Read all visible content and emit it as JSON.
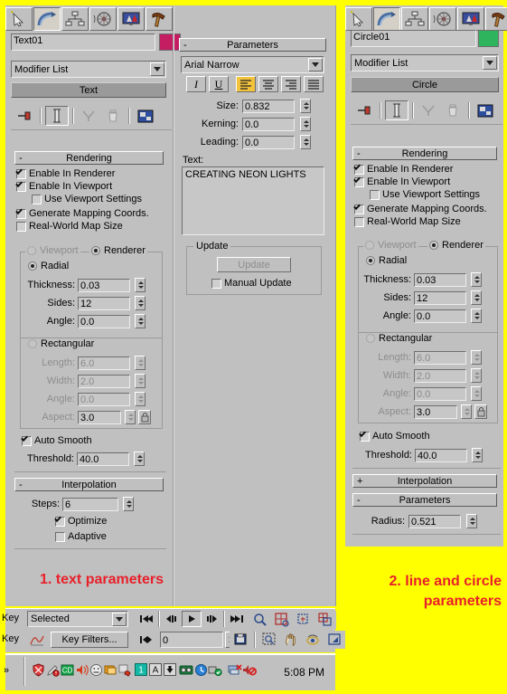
{
  "colors": {
    "border_yellow": "#ffff00",
    "panel_gray": "#c0c0c0",
    "caption_red": "#e8202a",
    "text01_swatch": "#c41d62",
    "circle01_swatch": "#2fb45e",
    "align_highlight": "#f3c33c"
  },
  "left_panel": {
    "tabs": [
      {
        "name": "create-tab",
        "icon": "arrow-star-icon",
        "selected": false
      },
      {
        "name": "modify-tab",
        "icon": "rainbow-arc-icon",
        "selected": true
      },
      {
        "name": "hierarchy-tab",
        "icon": "hierarchy-tree-icon",
        "selected": false
      },
      {
        "name": "motion-tab",
        "icon": "wheel-icon",
        "selected": false
      },
      {
        "name": "display-tab",
        "icon": "monitor-icon",
        "selected": false
      },
      {
        "name": "utilities-tab",
        "icon": "hammer-icon",
        "selected": false
      }
    ],
    "object_name": "Text01",
    "modifier_list_label": "Modifier List",
    "stack_item": "Text",
    "stack_tools": [
      {
        "name": "pin-stack-button",
        "icon": "pin-icon"
      },
      {
        "name": "show-end-result-button",
        "icon": "show-end-result-icon"
      },
      {
        "name": "make-unique-button",
        "icon": "make-unique-icon"
      },
      {
        "name": "remove-modifier-button",
        "icon": "trash-icon"
      },
      {
        "name": "configure-modifier-sets-button",
        "icon": "configure-sets-icon"
      }
    ],
    "rendering": {
      "title": "Rendering",
      "expanded": true,
      "enable_in_renderer": {
        "label": "Enable In Renderer",
        "checked": true
      },
      "enable_in_viewport": {
        "label": "Enable In Viewport",
        "checked": true
      },
      "use_viewport_settings": {
        "label": "Use Viewport Settings",
        "checked": false
      },
      "generate_mapping_coords": {
        "label": "Generate Mapping Coords.",
        "checked": true
      },
      "real_world_map_size": {
        "label": "Real-World Map Size",
        "checked": false
      },
      "viewport_radio": {
        "label": "Viewport",
        "selected": false,
        "disabled": true
      },
      "renderer_radio": {
        "label": "Renderer",
        "selected": true
      },
      "radial": {
        "label": "Radial",
        "selected": true
      },
      "thickness": {
        "label": "Thickness:",
        "value": "0.03"
      },
      "sides": {
        "label": "Sides:",
        "value": "12"
      },
      "angle": {
        "label": "Angle:",
        "value": "0.0"
      },
      "rectangular": {
        "label": "Rectangular",
        "selected": false
      },
      "length": {
        "label": "Length:",
        "value": "6.0"
      },
      "width": {
        "label": "Width:",
        "value": "2.0"
      },
      "rect_angle": {
        "label": "Angle:",
        "value": "0.0"
      },
      "aspect": {
        "label": "Aspect:",
        "value": "3.0"
      },
      "auto_smooth": {
        "label": "Auto Smooth",
        "checked": true
      },
      "threshold": {
        "label": "Threshold:",
        "value": "40.0"
      }
    },
    "interpolation": {
      "title": "Interpolation",
      "expanded": true,
      "steps": {
        "label": "Steps:",
        "value": "6"
      },
      "optimize": {
        "label": "Optimize",
        "checked": true
      },
      "adaptive": {
        "label": "Adaptive",
        "checked": false
      }
    }
  },
  "middle_panel": {
    "title": "Parameters",
    "font": "Arial Narrow",
    "style_buttons": [
      {
        "name": "italic-button",
        "label": "I",
        "active": false
      },
      {
        "name": "underline-button",
        "label": "U",
        "active": false
      }
    ],
    "align_buttons": [
      {
        "name": "align-left-button",
        "icon": "align-left-icon",
        "active": true
      },
      {
        "name": "align-center-button",
        "icon": "align-center-icon",
        "active": false
      },
      {
        "name": "align-right-button",
        "icon": "align-right-icon",
        "active": false
      },
      {
        "name": "align-justify-button",
        "icon": "align-justify-icon",
        "active": false
      }
    ],
    "size": {
      "label": "Size:",
      "value": "0.832"
    },
    "kerning": {
      "label": "Kerning:",
      "value": "0.0"
    },
    "leading": {
      "label": "Leading:",
      "value": "0.0"
    },
    "text_label": "Text:",
    "text_value": "CREATING NEON LIGHTS",
    "update": {
      "group_label": "Update",
      "button_label": "Update",
      "manual_update": {
        "label": "Manual Update",
        "checked": false
      }
    }
  },
  "right_panel": {
    "tabs": [
      {
        "name": "create-tab",
        "icon": "arrow-star-icon",
        "selected": false
      },
      {
        "name": "modify-tab",
        "icon": "rainbow-arc-icon",
        "selected": true
      },
      {
        "name": "hierarchy-tab",
        "icon": "hierarchy-tree-icon",
        "selected": false
      },
      {
        "name": "motion-tab",
        "icon": "wheel-icon",
        "selected": false
      },
      {
        "name": "display-tab",
        "icon": "monitor-icon",
        "selected": false
      },
      {
        "name": "utilities-tab",
        "icon": "hammer-icon",
        "selected": false
      }
    ],
    "object_name": "Circle01",
    "modifier_list_label": "Modifier List",
    "stack_item": "Circle",
    "rendering": {
      "title": "Rendering",
      "expanded": true,
      "enable_in_renderer": {
        "label": "Enable In Renderer",
        "checked": true
      },
      "enable_in_viewport": {
        "label": "Enable In Viewport",
        "checked": true
      },
      "use_viewport_settings": {
        "label": "Use Viewport Settings",
        "checked": false
      },
      "generate_mapping_coords": {
        "label": "Generate Mapping Coords.",
        "checked": true
      },
      "real_world_map_size": {
        "label": "Real-World Map Size",
        "checked": false
      },
      "viewport_radio": {
        "label": "Viewport",
        "selected": false,
        "disabled": true
      },
      "renderer_radio": {
        "label": "Renderer",
        "selected": true
      },
      "radial": {
        "label": "Radial",
        "selected": true
      },
      "thickness": {
        "label": "Thickness:",
        "value": "0.03"
      },
      "sides": {
        "label": "Sides:",
        "value": "12"
      },
      "angle": {
        "label": "Angle:",
        "value": "0.0"
      },
      "rectangular": {
        "label": "Rectangular",
        "selected": false
      },
      "length": {
        "label": "Length:",
        "value": "6.0"
      },
      "width": {
        "label": "Width:",
        "value": "2.0"
      },
      "rect_angle": {
        "label": "Angle:",
        "value": "0.0"
      },
      "aspect": {
        "label": "Aspect:",
        "value": "3.0"
      },
      "auto_smooth": {
        "label": "Auto Smooth",
        "checked": true
      },
      "threshold": {
        "label": "Threshold:",
        "value": "40.0"
      }
    },
    "interpolation": {
      "title": "Interpolation",
      "expanded": false
    },
    "parameters": {
      "title": "Parameters",
      "expanded": true,
      "radius": {
        "label": "Radius:",
        "value": "0.521"
      }
    }
  },
  "bottom_bar": {
    "key_label_1": "Key",
    "key_label_2": "Key",
    "selection_dropdown": "Selected",
    "key_filters_button": "Key Filters...",
    "frame_value": "0",
    "playback_buttons": [
      {
        "name": "go-to-start-button",
        "icon": "skip-back-icon"
      },
      {
        "name": "previous-frame-button",
        "icon": "step-back-icon"
      },
      {
        "name": "play-animation-button",
        "icon": "play-icon"
      },
      {
        "name": "next-frame-button",
        "icon": "step-forward-icon"
      },
      {
        "name": "go-to-end-button",
        "icon": "skip-forward-icon"
      }
    ],
    "view_buttons_row1": [
      {
        "name": "zoom-button",
        "icon": "magnifier-icon"
      },
      {
        "name": "zoom-all-button",
        "icon": "zoom-all-icon"
      },
      {
        "name": "zoom-extents-button",
        "icon": "zoom-extents-icon"
      },
      {
        "name": "zoom-extents-all-button",
        "icon": "zoom-extents-all-icon"
      }
    ],
    "view_buttons_row2": [
      {
        "name": "set-key-button",
        "icon": "set-key-icon"
      },
      {
        "name": "zoom-region-button",
        "icon": "zoom-region-icon"
      },
      {
        "name": "pan-button",
        "icon": "hand-icon"
      },
      {
        "name": "arc-rotate-button",
        "icon": "arc-rotate-icon"
      },
      {
        "name": "maximize-viewport-button",
        "icon": "maximize-viewport-icon"
      }
    ],
    "curve-editor-button": {
      "name": "curve-editor-button",
      "icon": "curve-icon"
    }
  },
  "taskbar": {
    "overflow_label": "»",
    "clock": "5:08 PM",
    "tray_icons": [
      {
        "name": "antivirus-shield-icon",
        "glyph": "shield"
      },
      {
        "name": "network-alert-icon",
        "glyph": "pen"
      },
      {
        "name": "cd-drive-icon",
        "glyph": "cd"
      },
      {
        "name": "volume-icon",
        "glyph": "speaker"
      },
      {
        "name": "messenger-icon",
        "glyph": "face"
      },
      {
        "name": "display-icon",
        "glyph": "screen"
      },
      {
        "name": "update-icon",
        "glyph": "hand"
      },
      {
        "name": "num-indicator-icon",
        "glyph": "1"
      },
      {
        "name": "letter-indicator-icon",
        "glyph": "A"
      },
      {
        "name": "arrow-indicator-icon",
        "glyph": "down"
      },
      {
        "name": "camera-icon",
        "glyph": "camera"
      },
      {
        "name": "clock-sync-icon",
        "glyph": "clock"
      },
      {
        "name": "usb-ok-icon",
        "glyph": "usb"
      },
      {
        "name": "network-disconnect-icon",
        "glyph": "netx"
      },
      {
        "name": "mute-icon",
        "glyph": "mute"
      }
    ]
  },
  "captions": {
    "left": "1. text parameters",
    "right_line1": "2. line and circle",
    "right_line2": "parameters"
  }
}
